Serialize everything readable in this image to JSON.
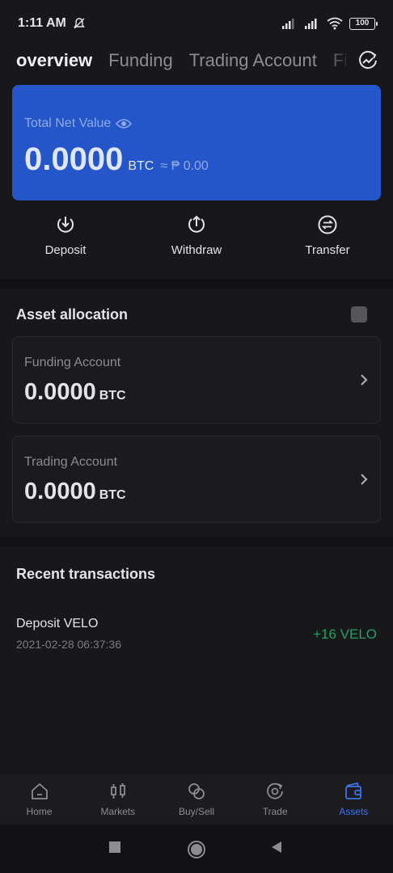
{
  "status_bar": {
    "time": "1:11 AM",
    "battery": "100"
  },
  "tabs": [
    {
      "label": "overview",
      "active": true
    },
    {
      "label": "Funding",
      "active": false
    },
    {
      "label": "Trading Account",
      "active": false
    },
    {
      "label": "Fi",
      "active": false
    }
  ],
  "net_value": {
    "label": "Total Net Value",
    "amount": "0.0000",
    "unit": "BTC",
    "fiat": "≈ ₱ 0.00"
  },
  "actions": [
    {
      "label": "Deposit",
      "icon": "deposit-icon"
    },
    {
      "label": "Withdraw",
      "icon": "withdraw-icon"
    },
    {
      "label": "Transfer",
      "icon": "transfer-icon"
    }
  ],
  "asset_allocation": {
    "title": "Asset allocation",
    "accounts": [
      {
        "name": "Funding Account",
        "amount": "0.0000",
        "unit": "BTC"
      },
      {
        "name": "Trading Account",
        "amount": "0.0000",
        "unit": "BTC"
      }
    ]
  },
  "recent_transactions": {
    "title": "Recent transactions",
    "items": [
      {
        "title": "Deposit VELO",
        "date": "2021-02-28 06:37:36",
        "amount": "+16 VELO"
      }
    ]
  },
  "bottom_nav": [
    {
      "label": "Home",
      "icon": "home-icon",
      "active": false
    },
    {
      "label": "Markets",
      "icon": "candlestick-icon",
      "active": false
    },
    {
      "label": "Buy/Sell",
      "icon": "coins-icon",
      "active": false
    },
    {
      "label": "Trade",
      "icon": "trade-icon",
      "active": false
    },
    {
      "label": "Assets",
      "icon": "wallet-icon",
      "active": true
    }
  ],
  "colors": {
    "background": "#18181b",
    "card_blue": "#2556c9",
    "accent_blue": "#3d72ec",
    "positive_green": "#23a064"
  }
}
